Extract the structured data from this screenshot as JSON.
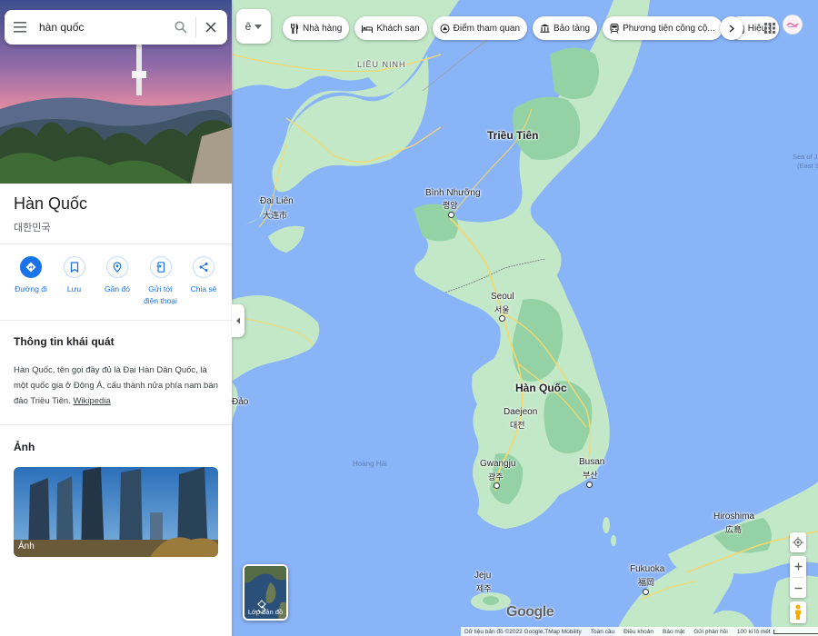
{
  "search": {
    "value": "hàn quốc"
  },
  "place": {
    "title": "Hàn Quốc",
    "native_name": "대한민국"
  },
  "actions": [
    {
      "label": "Đường đi",
      "icon": "directions-icon"
    },
    {
      "label": "Lưu",
      "icon": "bookmark-icon"
    },
    {
      "label": "Gần đó",
      "icon": "nearby-icon"
    },
    {
      "label": "Gửi tới điện thoại",
      "icon": "send-to-phone-icon"
    },
    {
      "label": "Chia sẻ",
      "icon": "share-icon"
    }
  ],
  "overview": {
    "heading": "Thông tin khái quát",
    "text": "Hàn Quốc, tên gọi đầy đủ là Đại Hàn Dân Quốc, là một quốc gia ở Đông Á, cấu thành nửa phía nam bán đảo Triều Tiên. ",
    "source_link": "Wikipedia"
  },
  "photos": {
    "heading": "Ảnh",
    "card_caption": "Ảnh"
  },
  "map": {
    "layer_select_label": "ê",
    "chips": [
      {
        "label": "Nhà hàng",
        "icon": "restaurant-icon"
      },
      {
        "label": "Khách sạn",
        "icon": "hotel-icon"
      },
      {
        "label": "Điểm tham quan",
        "icon": "attraction-icon"
      },
      {
        "label": "Bảo tàng",
        "icon": "museum-icon"
      },
      {
        "label": "Phương tiện công cộ...",
        "icon": "transit-icon"
      },
      {
        "label": "Hiệu t",
        "icon": "pharmacy-icon"
      }
    ],
    "labels": {
      "lieu_ninh": "LIÊU NINH",
      "trieu_tien": "Triều Tiên",
      "binh_nhuong": "Bình Nhưỡng",
      "binh_nhuong_native": "평양",
      "dai_lien": "Đại Liên",
      "dai_lien_native": "大连市",
      "seoul": "Seoul",
      "seoul_native": "서울",
      "han_quoc": "Hàn Quốc",
      "daejeon": "Daejeon",
      "daejeon_native": "대전",
      "gwangju": "Gwangju",
      "gwangju_native": "광주",
      "busan": "Busan",
      "busan_native": "부산",
      "hoang_hai": "Hoàng Hải",
      "jeju": "Jeju",
      "jeju_native": "제주",
      "fukuoka": "Fukuoka",
      "fukuoka_native": "福岡",
      "hiroshima": "Hiroshima",
      "hiroshima_native": "広島",
      "dao": "Đảo",
      "sea_of_japan_1": "Sea of Ja",
      "sea_of_japan_2": "(East S"
    },
    "layers_label": "Lớp bản đồ",
    "google_logo": "Google",
    "footer": {
      "attribution": "Dữ liệu bản đồ ©2022 Google,TMap Mobility",
      "terms": "Toàn cầu",
      "privacy_terms": "Điều khoản",
      "privacy": "Bảo mật",
      "feedback": "Gửi phản hồi",
      "scale": "100 ki lô mét"
    }
  },
  "colors": {
    "water": "#8ab4f8",
    "land": "#c3e8c8",
    "land_dark": "#94d2a5",
    "road": "#f6d86b",
    "accent": "#1a73e8"
  }
}
